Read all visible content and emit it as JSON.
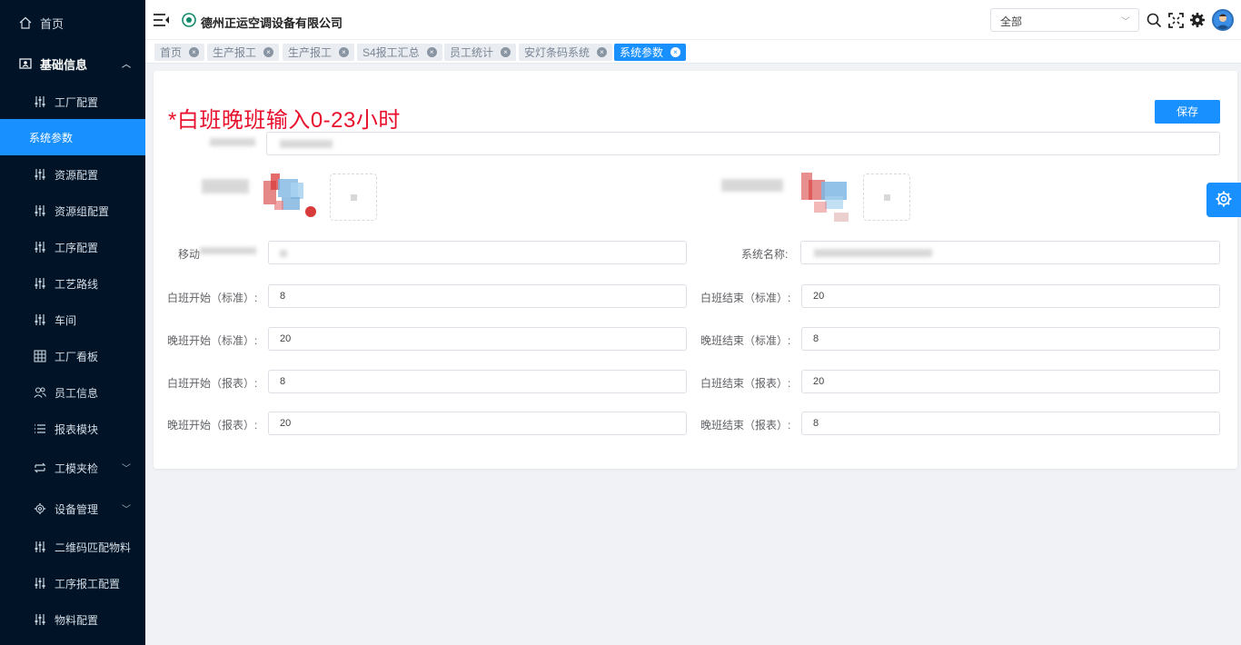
{
  "sidebar": {
    "home": "首页",
    "basic_info": "基础信息",
    "items": [
      {
        "label": "工厂配置",
        "icon": "sliders-icon"
      },
      {
        "label": "系统参数",
        "icon": ""
      },
      {
        "label": "资源配置",
        "icon": "sliders-icon"
      },
      {
        "label": "资源组配置",
        "icon": "sliders-icon"
      },
      {
        "label": "工序配置",
        "icon": "sliders-icon"
      },
      {
        "label": "工艺路线",
        "icon": "sliders-icon"
      },
      {
        "label": "车间",
        "icon": "sliders-icon"
      },
      {
        "label": "工厂看板",
        "icon": "grid-icon"
      },
      {
        "label": "员工信息",
        "icon": "users-icon"
      },
      {
        "label": "报表模块",
        "icon": "list-icon"
      },
      {
        "label": "工模夹检",
        "icon": "swap-icon"
      },
      {
        "label": "设备管理",
        "icon": "gear-icon"
      },
      {
        "label": "二维码匹配物料",
        "icon": "sliders-icon"
      },
      {
        "label": "工序报工配置",
        "icon": "sliders-icon"
      },
      {
        "label": "物料配置",
        "icon": "sliders-icon"
      }
    ]
  },
  "header": {
    "company": "德州正运空调设备有限公司",
    "select_value": "全部"
  },
  "tabs": [
    {
      "label": "首页"
    },
    {
      "label": "生产报工"
    },
    {
      "label": "生产报工"
    },
    {
      "label": "S4报工汇总"
    },
    {
      "label": "员工统计"
    },
    {
      "label": "安灯条码系统"
    },
    {
      "label": "系统参数"
    }
  ],
  "form": {
    "notice": "*白班晚班输入0-23小时",
    "save": "保存",
    "mobile_label_partial": "移动",
    "system_name_label": "系统名称:",
    "rows": [
      {
        "left_label": "白班开始（标准）:",
        "left_value": "8",
        "right_label": "白班结束（标准）:",
        "right_value": "20"
      },
      {
        "left_label": "晚班开始（标准）:",
        "left_value": "20",
        "right_label": "晚班结束（标准）:",
        "right_value": "8"
      },
      {
        "left_label": "白班开始（报表）:",
        "left_value": "8",
        "right_label": "白班结束（报表）:",
        "right_value": "20"
      },
      {
        "left_label": "晚班开始（报表）:",
        "left_value": "20",
        "right_label": "晚班结束（报表）:",
        "right_value": "8"
      }
    ]
  },
  "colors": {
    "sidebar_bg": "#011427",
    "accent": "#1890ff",
    "notice": "#e8102c"
  }
}
